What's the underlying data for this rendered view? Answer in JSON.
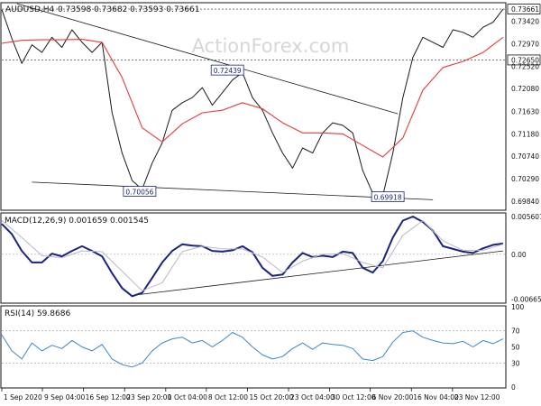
{
  "symbol_line": {
    "symbol": "AUDUSD,H4",
    "ohlc": "0.73598 0.73682 0.73593 0.73661"
  },
  "watermark": "ActionForex.com",
  "colors": {
    "price": "#1a1a1a",
    "ma": "#e83a3a",
    "macd_line": "#1a237e",
    "macd_signal": "#b8b8c8",
    "rsi_line": "#3a86d0",
    "trendline": "#1a1a1a",
    "dotted_level": "#333333",
    "label_border": "#1a237e",
    "watermark": "#d6d6d6"
  },
  "chart_data": [
    {
      "type": "line",
      "panel": "price",
      "ylim": [
        0.6968,
        0.7377
      ],
      "yticks": [
        "0.73661",
        "0.73420",
        "0.72970",
        "0.72650",
        "0.72520",
        "0.72080",
        "0.71630",
        "0.71180",
        "0.70740",
        "0.70290",
        "0.69840"
      ],
      "highlighted_levels": [
        "0.73661",
        "0.72650"
      ],
      "series": [
        {
          "role": "price",
          "x": [
            0,
            2,
            4,
            6,
            8,
            10,
            12,
            14,
            16,
            18,
            20,
            22,
            24,
            26,
            28,
            30,
            32,
            34,
            36,
            38,
            40,
            42,
            44,
            46,
            48,
            50,
            52,
            54,
            56,
            58,
            60,
            62,
            64,
            66,
            68,
            70,
            72,
            74,
            76,
            78,
            80,
            82,
            84,
            86,
            88,
            90,
            92,
            94,
            96,
            98,
            100
          ],
          "values": [
            0.7365,
            0.7308,
            0.7258,
            0.7295,
            0.728,
            0.731,
            0.729,
            0.7325,
            0.73,
            0.728,
            0.73,
            0.716,
            0.708,
            0.7025,
            0.7008,
            0.706,
            0.71,
            0.7165,
            0.718,
            0.719,
            0.721,
            0.7175,
            0.72,
            0.7225,
            0.724,
            0.719,
            0.7165,
            0.712,
            0.708,
            0.705,
            0.709,
            0.708,
            0.712,
            0.714,
            0.7135,
            0.712,
            0.7045,
            0.7,
            0.6995,
            0.708,
            0.719,
            0.727,
            0.731,
            0.73,
            0.729,
            0.7325,
            0.732,
            0.731,
            0.733,
            0.734,
            0.7366
          ]
        },
        {
          "role": "moving-average",
          "x": [
            0,
            4,
            8,
            12,
            16,
            20,
            24,
            28,
            32,
            36,
            40,
            44,
            48,
            52,
            56,
            60,
            64,
            68,
            72,
            76,
            80,
            84,
            88,
            92,
            96,
            100
          ],
          "values": [
            0.7298,
            0.7304,
            0.7305,
            0.7305,
            0.7306,
            0.73,
            0.723,
            0.713,
            0.7102,
            0.7138,
            0.716,
            0.7165,
            0.718,
            0.7168,
            0.714,
            0.712,
            0.712,
            0.7118,
            0.7095,
            0.7072,
            0.711,
            0.7205,
            0.725,
            0.7262,
            0.728,
            0.731
          ]
        }
      ],
      "lines": [
        {
          "role": "descending-trendline",
          "x": [
            3,
            79
          ],
          "y": [
            0.7377,
            0.7158
          ]
        },
        {
          "role": "support-line",
          "x": [
            6,
            86
          ],
          "y": [
            0.7022,
            0.6987
          ]
        }
      ],
      "annotations": [
        {
          "text": "0.72439",
          "x": 45,
          "y": 0.7244
        },
        {
          "text": "0.70056",
          "x": 27.5,
          "y": 0.7003
        },
        {
          "text": "0.69918",
          "x": 77,
          "y": 0.6992
        }
      ]
    },
    {
      "type": "line",
      "panel": "macd",
      "title": "MACD(12,26,9) 0.001659 0.001545",
      "ylim": [
        -0.0071,
        0.006
      ],
      "yticks": [
        "0.005607",
        "0.00",
        "-0.006656"
      ],
      "series": [
        {
          "role": "macd",
          "x": [
            0,
            2,
            4,
            6,
            8,
            10,
            12,
            14,
            16,
            18,
            20,
            22,
            24,
            26,
            28,
            30,
            32,
            34,
            36,
            38,
            40,
            42,
            44,
            46,
            48,
            50,
            52,
            54,
            56,
            58,
            60,
            62,
            64,
            66,
            68,
            70,
            72,
            74,
            76,
            78,
            80,
            82,
            84,
            86,
            88,
            90,
            92,
            94,
            96,
            98,
            100
          ],
          "values": [
            0.0045,
            0.003,
            0.0005,
            -0.0012,
            -0.0012,
            0.0001,
            -0.0003,
            0.0005,
            0.0012,
            0.0005,
            -0.0003,
            -0.0028,
            -0.005,
            -0.0062,
            -0.0057,
            -0.0035,
            -0.0012,
            0.0005,
            0.0015,
            0.0013,
            0.0012,
            0.0005,
            0.0004,
            0.0006,
            0.0012,
            0.0003,
            -0.002,
            -0.0032,
            -0.003,
            -0.0012,
            0.0002,
            -0.0004,
            -0.0002,
            -0.0004,
            0.0004,
            0.0002,
            -0.002,
            -0.0027,
            -0.001,
            0.0025,
            0.005,
            0.0056,
            0.0048,
            0.0035,
            0.0012,
            0.0008,
            0.0004,
            0.0002,
            0.0009,
            0.0014,
            0.0016
          ]
        },
        {
          "role": "signal",
          "x": [
            0,
            4,
            8,
            12,
            16,
            20,
            24,
            28,
            32,
            36,
            40,
            44,
            48,
            52,
            56,
            60,
            64,
            68,
            72,
            76,
            80,
            84,
            88,
            92,
            96,
            100
          ],
          "values": [
            0.005,
            0.0025,
            -0.0002,
            -0.0005,
            0.0005,
            0.0004,
            -0.0025,
            -0.0054,
            -0.0042,
            0.0004,
            0.0012,
            0.0008,
            0.0008,
            -0.0004,
            -0.0027,
            -0.001,
            0.0,
            0.0001,
            -0.0012,
            -0.002,
            0.0028,
            0.005,
            0.002,
            0.0006,
            0.0006,
            0.0015
          ]
        }
      ],
      "lines": [
        {
          "role": "trendline",
          "x": [
            27,
            100
          ],
          "y": [
            -0.006,
            0.0005
          ]
        }
      ]
    },
    {
      "type": "line",
      "panel": "rsi",
      "title": "RSI(14) 59.8686",
      "ylim": [
        0,
        100
      ],
      "yticks": [
        100,
        70,
        50,
        30,
        0
      ],
      "levels": [
        70,
        30
      ],
      "series": [
        {
          "role": "rsi",
          "x": [
            0,
            2,
            4,
            6,
            8,
            10,
            12,
            14,
            16,
            18,
            20,
            22,
            24,
            26,
            28,
            30,
            32,
            34,
            36,
            38,
            40,
            42,
            44,
            46,
            48,
            50,
            52,
            54,
            56,
            58,
            60,
            62,
            64,
            66,
            68,
            70,
            72,
            74,
            76,
            78,
            80,
            82,
            84,
            86,
            88,
            90,
            92,
            94,
            96,
            98,
            100
          ],
          "values": [
            65,
            45,
            35,
            55,
            45,
            52,
            48,
            58,
            50,
            45,
            53,
            35,
            28,
            25,
            30,
            45,
            55,
            60,
            62,
            55,
            58,
            50,
            58,
            68,
            62,
            50,
            40,
            35,
            38,
            48,
            55,
            47,
            55,
            53,
            52,
            48,
            35,
            33,
            38,
            56,
            68,
            70,
            62,
            58,
            55,
            54,
            57,
            50,
            58,
            54,
            60
          ]
        }
      ]
    }
  ],
  "x_axis": {
    "labels": [
      "1 Sep 2020",
      "9 Sep 04:00",
      "16 Sep 12:00",
      "23 Sep 20:00",
      "1 Oct 04:00",
      "8 Oct 12:00",
      "15 Oct 20:00",
      "23 Oct 04:00",
      "30 Oct 12:00",
      "6 Nov 20:00",
      "16 Nov 04:00",
      "23 Nov 12:00"
    ],
    "positions": [
      0,
      8.1,
      16.3,
      24.5,
      32.7,
      40.8,
      49.0,
      57.2,
      65.4,
      73.5,
      81.7,
      89.9
    ]
  }
}
